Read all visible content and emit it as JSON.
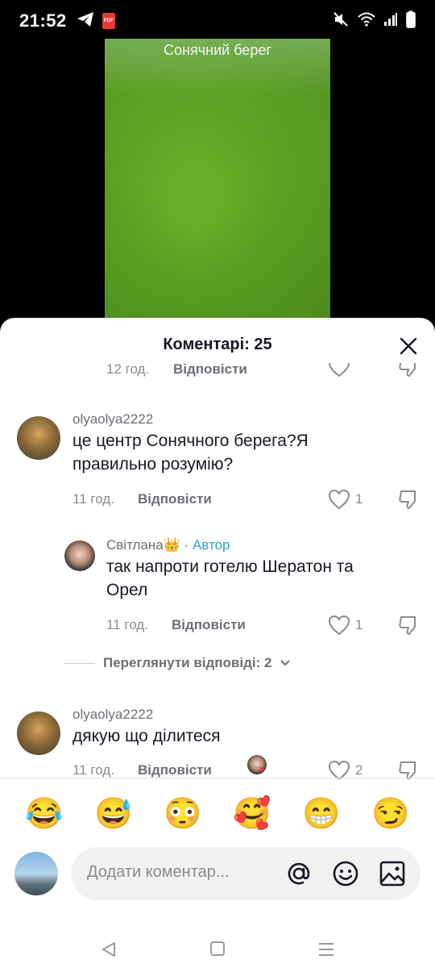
{
  "status_bar": {
    "time": "21:52",
    "pdf_label": "PDF"
  },
  "video": {
    "caption": "Сонячний берег"
  },
  "sheet": {
    "title": "Коментарі: 25",
    "partial_time": "12 год.",
    "partial_reply": "Відповісти"
  },
  "comments": [
    {
      "username": "olyaolya2222",
      "text_line1": "це центр Сонячного берега?Я",
      "text_line2": "правильно розумію?",
      "time": "11 год.",
      "reply": "Відповісти",
      "likes": "1"
    },
    {
      "username": "Світлана",
      "crown": "👑",
      "separator": " · ",
      "author_tag": "Автор",
      "text_line1": "так напроти готелю Шератон та",
      "text_line2": "Орел",
      "time": "11 год.",
      "reply": "Відповісти",
      "likes": "1"
    },
    {
      "username": "olyaolya2222",
      "text_line1": "дякую що ділитеся",
      "time": "11 год.",
      "reply": "Відповісти",
      "likes": "2"
    }
  ],
  "view_replies": "Переглянути відповіді: 2",
  "emojis": [
    "😂",
    "😅",
    "😳",
    "🥰",
    "😁",
    "😏"
  ],
  "input": {
    "placeholder": "Додати коментар..."
  },
  "colors": {
    "author": "#2a9fd6",
    "text": "#161823",
    "meta": "#8a8b91"
  }
}
